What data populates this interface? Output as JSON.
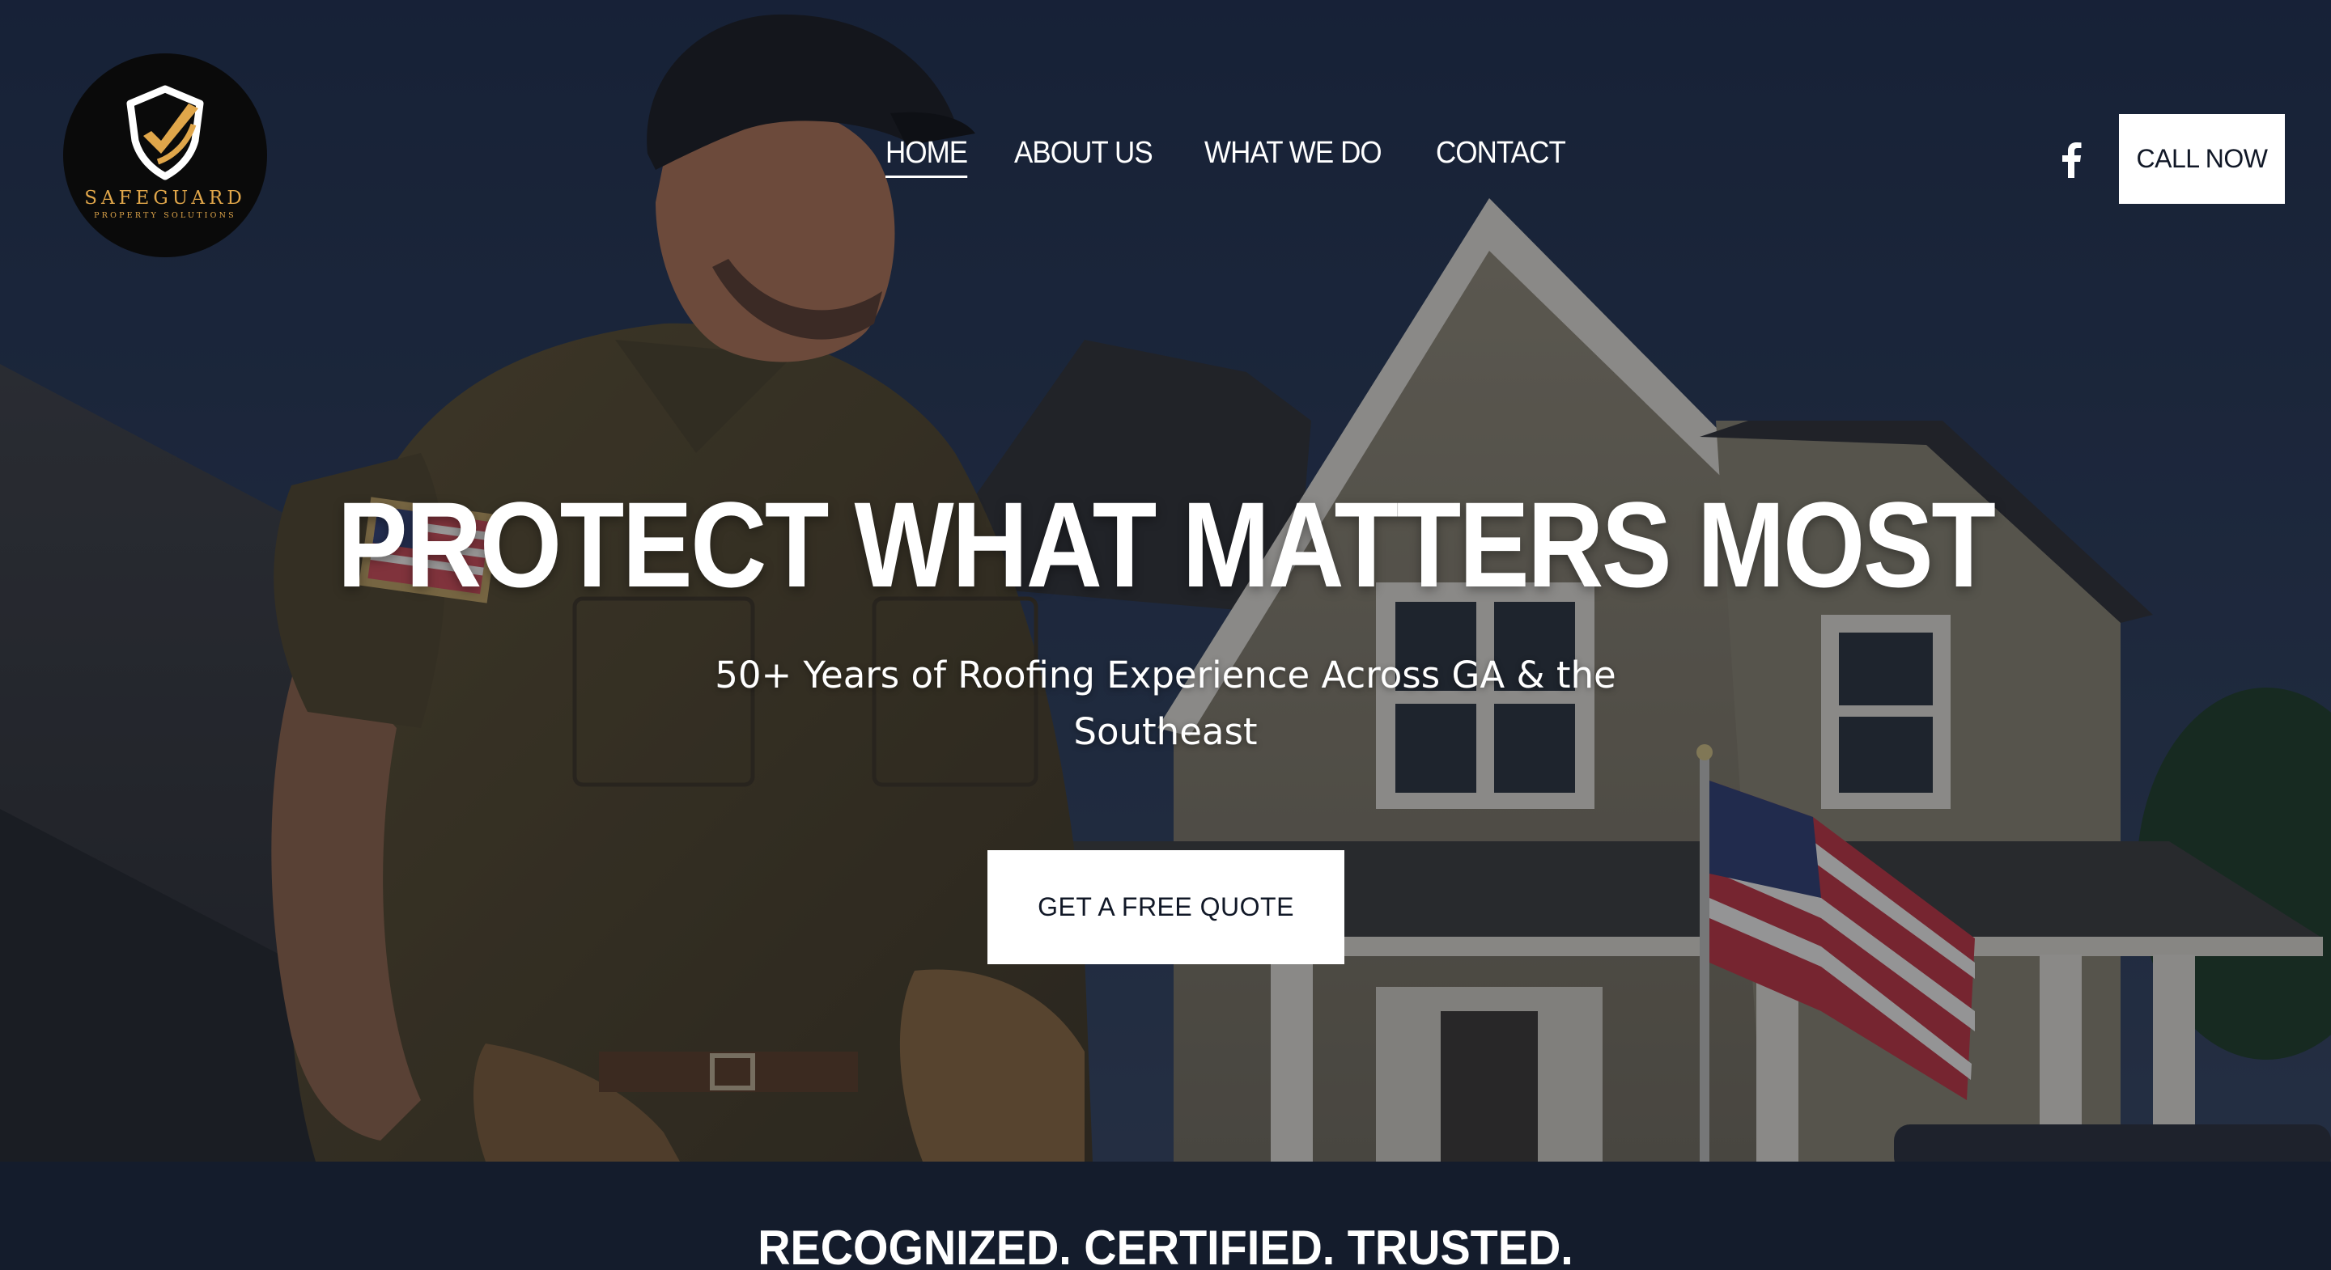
{
  "brand": {
    "name": "SAFEGUARD",
    "tagline": "PROPERTY SOLUTIONS",
    "accent_color": "#e0a64a"
  },
  "nav": {
    "items": [
      {
        "label": "HOME",
        "active": true
      },
      {
        "label": "ABOUT US",
        "active": false
      },
      {
        "label": "WHAT WE DO",
        "active": false
      },
      {
        "label": "CONTACT",
        "active": false
      }
    ]
  },
  "header": {
    "social_icon": "facebook-icon",
    "call_label": "CALL NOW"
  },
  "hero": {
    "title": "PROTECT WHAT MATTERS MOST",
    "subtitle": "50+ Years of Roofing Experience Across GA & the Southeast",
    "cta_label": "GET A FREE QUOTE",
    "background": "roofer-in-front-of-house-photo"
  },
  "trust_band": {
    "title": "RECOGNIZED. CERTIFIED. TRUSTED."
  },
  "colors": {
    "band_background": "#141c2c",
    "button_background": "#ffffff",
    "button_text": "#111827"
  }
}
